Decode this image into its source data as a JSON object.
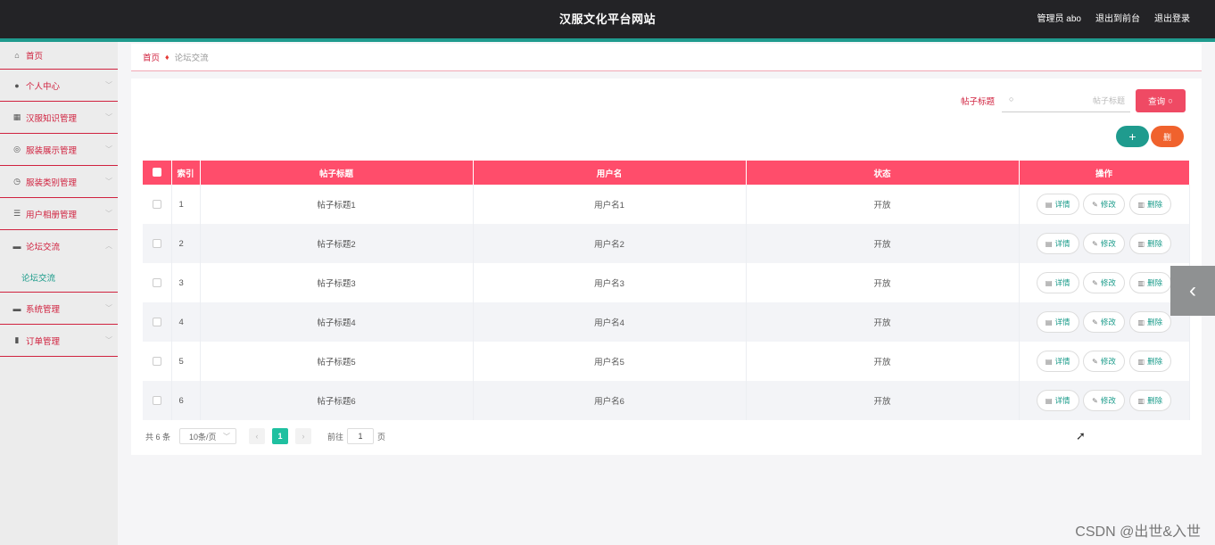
{
  "header": {
    "title": "汉服文化平台网站",
    "links": [
      "管理员 abo",
      "退出到前台",
      "退出登录"
    ]
  },
  "sidebar": {
    "items": [
      {
        "label": "首页",
        "icon": "home-icon",
        "glyph": "⌂"
      },
      {
        "label": "个人中心",
        "icon": "user-icon",
        "glyph": "●"
      },
      {
        "label": "汉服知识管理",
        "icon": "grid-icon",
        "glyph": "▦"
      },
      {
        "label": "服装展示管理",
        "icon": "globe-icon",
        "glyph": "◎"
      },
      {
        "label": "服装类别管理",
        "icon": "clock-icon",
        "glyph": "◷"
      },
      {
        "label": "用户相册管理",
        "icon": "list-icon",
        "glyph": "☰"
      },
      {
        "label": "论坛交流",
        "icon": "monitor-icon",
        "glyph": "▬"
      },
      {
        "label": "系统管理",
        "icon": "chat-icon",
        "glyph": "▬"
      },
      {
        "label": "订单管理",
        "icon": "bar-chart-icon",
        "glyph": "▮"
      }
    ],
    "submenu_label": "论坛交流"
  },
  "breadcrumb": {
    "home": "首页",
    "current": "论坛交流"
  },
  "search": {
    "label": "帖子标题",
    "placeholder": "帖子标题",
    "button_label": "查询"
  },
  "toolbar": {
    "add_label": "+",
    "delete_label": "删"
  },
  "table": {
    "headers": [
      "索引",
      "帖子标题",
      "用户名",
      "状态",
      "操作"
    ],
    "rows": [
      {
        "index": "1",
        "title": "帖子标题1",
        "user": "用户名1",
        "status": "开放"
      },
      {
        "index": "2",
        "title": "帖子标题2",
        "user": "用户名2",
        "status": "开放"
      },
      {
        "index": "3",
        "title": "帖子标题3",
        "user": "用户名3",
        "status": "开放"
      },
      {
        "index": "4",
        "title": "帖子标题4",
        "user": "用户名4",
        "status": "开放"
      },
      {
        "index": "5",
        "title": "帖子标题5",
        "user": "用户名5",
        "status": "开放"
      },
      {
        "index": "6",
        "title": "帖子标题6",
        "user": "用户名6",
        "status": "开放"
      }
    ],
    "actions": {
      "detail": "详情",
      "edit": "修改",
      "delete": "删除"
    }
  },
  "pagination": {
    "total": "共 6 条",
    "page_size": "10条/页",
    "current_page": "1",
    "goto_prefix": "前往",
    "goto_value": "1",
    "goto_suffix": "页"
  },
  "watermark": "CSDN @出世&入世",
  "colors": {
    "accent": "#ff4d6b",
    "brand_teal": "#1f9b8e",
    "header_bg": "#232326",
    "sidebar_text": "#d0223f"
  }
}
